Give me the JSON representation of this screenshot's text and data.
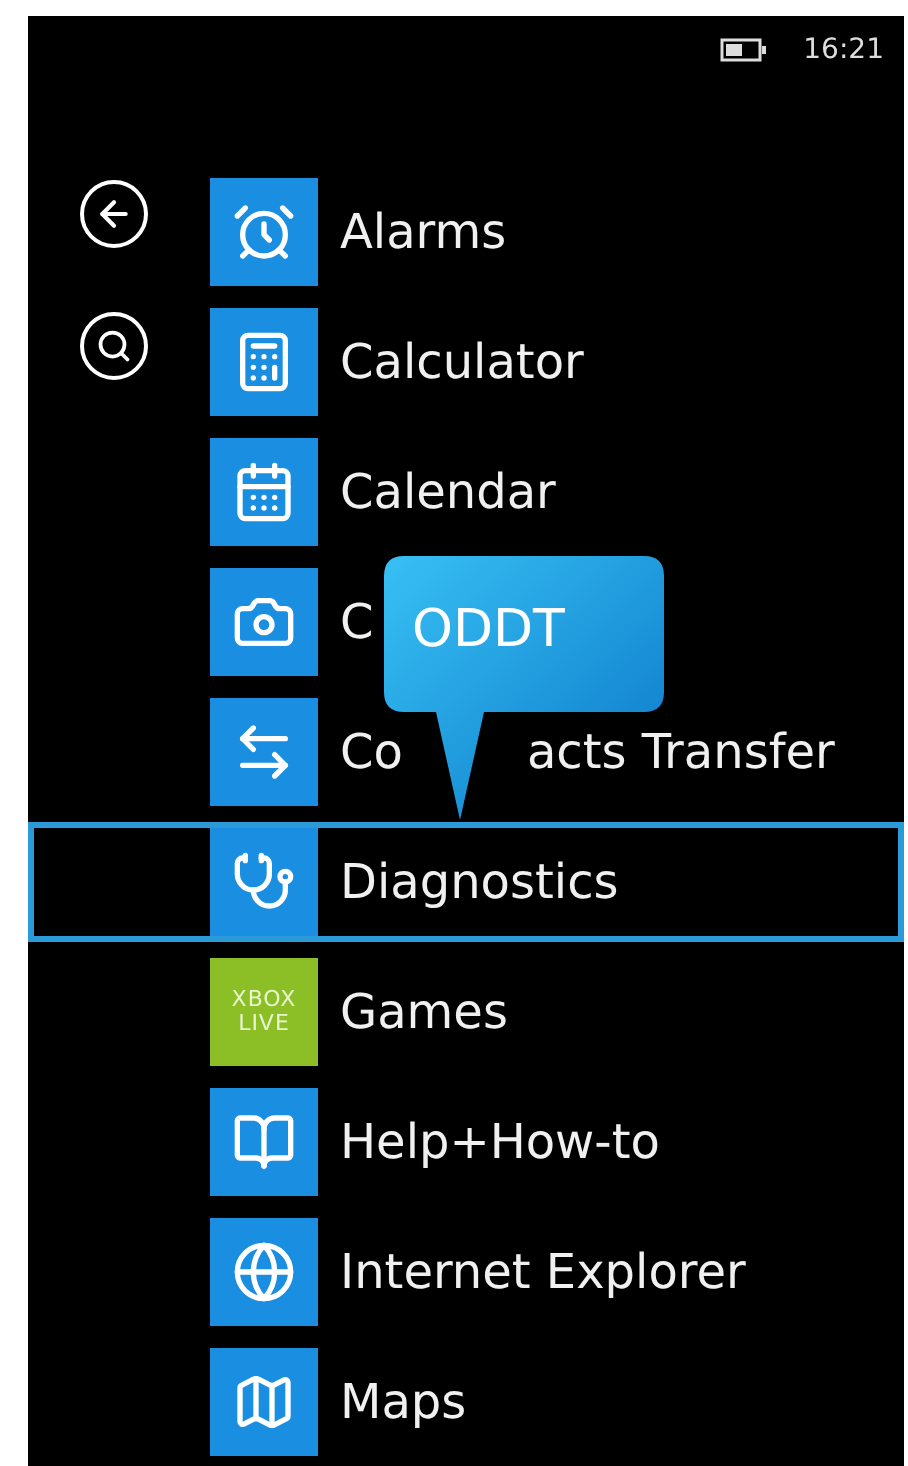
{
  "status_bar": {
    "time": "16:21"
  },
  "apps": [
    {
      "kind": "icon",
      "label_parts": [
        "Alarms"
      ],
      "color": "#1a8ee0",
      "selected": false
    },
    {
      "kind": "icon",
      "label_parts": [
        "Calculator"
      ],
      "color": "#1a8ee0",
      "selected": false
    },
    {
      "kind": "icon",
      "label_parts": [
        "Calendar"
      ],
      "color": "#1a8ee0",
      "selected": false
    },
    {
      "kind": "icon",
      "label_parts": [
        "C"
      ],
      "color": "#1a8ee0",
      "selected": false
    },
    {
      "kind": "icon",
      "label_parts": [
        "Co",
        "acts Transfer"
      ],
      "color": "#1a8ee0",
      "selected": false
    },
    {
      "kind": "icon",
      "label_parts": [
        "Diagnostics"
      ],
      "color": "#1a8ee0",
      "selected": true
    },
    {
      "kind": "text",
      "tile_text": [
        "XBOX",
        "LIVE"
      ],
      "label_parts": [
        "Games"
      ],
      "color": "#8cbf26",
      "selected": false
    },
    {
      "kind": "icon",
      "label_parts": [
        "Help+How-to"
      ],
      "color": "#1a8ee0",
      "selected": false
    },
    {
      "kind": "icon",
      "label_parts": [
        "Internet Explorer"
      ],
      "color": "#1a8ee0",
      "selected": false
    },
    {
      "kind": "icon",
      "label_parts": [
        "Maps"
      ],
      "color": "#1a8ee0",
      "selected": false
    }
  ],
  "callout": {
    "text": "ODDT"
  }
}
